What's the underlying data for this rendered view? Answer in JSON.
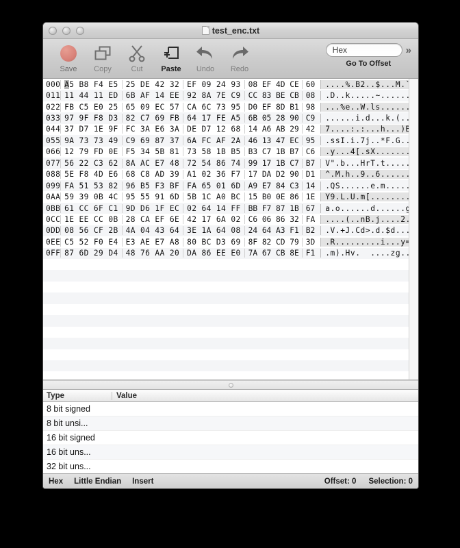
{
  "window": {
    "title": "test_enc.txt",
    "doc_icon": "document-icon",
    "traffic_lights": [
      "close-button",
      "minimize-button",
      "zoom-button"
    ]
  },
  "toolbar": {
    "items": [
      {
        "label": "Save",
        "icon": "save-icon",
        "state": "enabled-bold"
      },
      {
        "label": "Copy",
        "icon": "copy-icon",
        "state": "disabled"
      },
      {
        "label": "Cut",
        "icon": "cut-icon",
        "state": "disabled"
      },
      {
        "label": "Paste",
        "icon": "paste-icon",
        "state": "enabled-bold"
      },
      {
        "label": "Undo",
        "icon": "undo-icon",
        "state": "disabled"
      },
      {
        "label": "Redo",
        "icon": "redo-icon",
        "state": "disabled"
      }
    ],
    "goto_field_value": "Hex",
    "goto_label": "Go To Offset",
    "overflow_icon": "double-chevron-right-icon"
  },
  "hex_view": {
    "selected_byte_offset": "000",
    "rows": [
      {
        "offset": "000",
        "groups": [
          [
            "A5",
            "B8",
            "F4",
            "E5"
          ],
          [
            "25",
            "DE",
            "42",
            "32"
          ],
          [
            "EF",
            "09",
            "24",
            "93"
          ]
        ],
        "tail": "08 EF 4D CE",
        "last": "60",
        "ascii": "....%.B2..$...M.`"
      },
      {
        "offset": "011",
        "groups": [
          [
            "11",
            "44",
            "11",
            "ED"
          ],
          [
            "6B",
            "AF",
            "14",
            "EE"
          ],
          [
            "92",
            "8A",
            "7E",
            "C9"
          ]
        ],
        "tail": "CC 83 BE CB",
        "last": "08",
        "ascii": ".D..k.....~......"
      },
      {
        "offset": "022",
        "groups": [
          [
            "FB",
            "C5",
            "E0",
            "25"
          ],
          [
            "65",
            "09",
            "EC",
            "57"
          ],
          [
            "CA",
            "6C",
            "73",
            "95"
          ]
        ],
        "tail": "D0 EF 8D B1",
        "last": "98",
        "ascii": "...%e..W.ls......"
      },
      {
        "offset": "033",
        "groups": [
          [
            "97",
            "9F",
            "F8",
            "D3"
          ],
          [
            "82",
            "C7",
            "69",
            "FB"
          ],
          [
            "64",
            "17",
            "FE",
            "A5"
          ]
        ],
        "tail": "6B 05 28 90",
        "last": "C9",
        "ascii": "......i.d...k.(.."
      },
      {
        "offset": "044",
        "groups": [
          [
            "37",
            "D7",
            "1E",
            "9F"
          ],
          [
            "FC",
            "3A",
            "E6",
            "3A"
          ],
          [
            "DE",
            "D7",
            "12",
            "68"
          ]
        ],
        "tail": "14 A6 AB 29",
        "last": "42",
        "ascii": "7....:.:...h...)B"
      },
      {
        "offset": "055",
        "groups": [
          [
            "9A",
            "73",
            "73",
            "49"
          ],
          [
            "C9",
            "69",
            "87",
            "37"
          ],
          [
            "6A",
            "FC",
            "AF",
            "2A"
          ]
        ],
        "tail": "46 13 47 EC",
        "last": "95",
        "ascii": ".ssI.i.7j..*F.G.."
      },
      {
        "offset": "066",
        "groups": [
          [
            "12",
            "79",
            "FD",
            "0E"
          ],
          [
            "F5",
            "34",
            "5B",
            "81"
          ],
          [
            "73",
            "58",
            "1B",
            "B5"
          ]
        ],
        "tail": "B3 C7 1B B7",
        "last": "C6",
        "ascii": ".y...4[.sX......."
      },
      {
        "offset": "077",
        "groups": [
          [
            "56",
            "22",
            "C3",
            "62"
          ],
          [
            "8A",
            "AC",
            "E7",
            "48"
          ],
          [
            "72",
            "54",
            "86",
            "74"
          ]
        ],
        "tail": "99 17 1B C7",
        "last": "B7",
        "ascii": "V\".b...HrT.t....."
      },
      {
        "offset": "088",
        "groups": [
          [
            "5E",
            "F8",
            "4D",
            "E6"
          ],
          [
            "68",
            "C8",
            "AD",
            "39"
          ],
          [
            "A1",
            "02",
            "36",
            "F7"
          ]
        ],
        "tail": "17 DA D2 90",
        "last": "D1",
        "ascii": "^.M.h..9..6......"
      },
      {
        "offset": "099",
        "groups": [
          [
            "FA",
            "51",
            "53",
            "82"
          ],
          [
            "96",
            "B5",
            "F3",
            "BF"
          ],
          [
            "FA",
            "65",
            "01",
            "6D"
          ]
        ],
        "tail": "A9 E7 84 C3",
        "last": "14",
        "ascii": ".QS......e.m....."
      },
      {
        "offset": "0AA",
        "groups": [
          [
            "59",
            "39",
            "0B",
            "4C"
          ],
          [
            "95",
            "55",
            "91",
            "6D"
          ],
          [
            "5B",
            "1C",
            "A0",
            "BC"
          ]
        ],
        "tail": "15 B0 0E 86",
        "last": "1E",
        "ascii": "Y9.L.U.m[........"
      },
      {
        "offset": "0BB",
        "groups": [
          [
            "61",
            "CC",
            "6F",
            "C1"
          ],
          [
            "9D",
            "D6",
            "1F",
            "EC"
          ],
          [
            "02",
            "64",
            "14",
            "FF"
          ]
        ],
        "tail": "BB F7 87 1B",
        "last": "67",
        "ascii": "a.o......d......g"
      },
      {
        "offset": "0CC",
        "groups": [
          [
            "1E",
            "EE",
            "CC",
            "0B"
          ],
          [
            "28",
            "CA",
            "EF",
            "6E"
          ],
          [
            "42",
            "17",
            "6A",
            "02"
          ]
        ],
        "tail": "C6 06 86 32",
        "last": "FA",
        "ascii": "....(..nB.j....2."
      },
      {
        "offset": "0DD",
        "groups": [
          [
            "08",
            "56",
            "CF",
            "2B"
          ],
          [
            "4A",
            "04",
            "43",
            "64"
          ],
          [
            "3E",
            "1A",
            "64",
            "08"
          ]
        ],
        "tail": "24 64 A3 F1",
        "last": "B2",
        "ascii": ".V.+J.Cd>.d.$d..."
      },
      {
        "offset": "0EE",
        "groups": [
          [
            "C5",
            "52",
            "F0",
            "E4"
          ],
          [
            "E3",
            "AE",
            "E7",
            "A8"
          ],
          [
            "80",
            "BC",
            "D3",
            "69"
          ]
        ],
        "tail": "8F 82 CD 79",
        "last": "3D",
        "ascii": ".R.........i...y="
      },
      {
        "offset": "0FF",
        "groups": [
          [
            "87",
            "6D",
            "29",
            "D4"
          ],
          [
            "48",
            "76",
            "AA",
            "20"
          ],
          [
            "DA",
            "86",
            "EE",
            "E0"
          ]
        ],
        "tail": "7A 67 CB 8E",
        "last": "F1",
        "ascii": ".m).Hv.  ....zg..."
      }
    ]
  },
  "inspector": {
    "columns": [
      "Type",
      "Value"
    ],
    "rows": [
      {
        "type": "8 bit signed",
        "value": ""
      },
      {
        "type": "8 bit unsi...",
        "value": ""
      },
      {
        "type": "16 bit signed",
        "value": ""
      },
      {
        "type": "16 bit uns...",
        "value": ""
      },
      {
        "type": "32 bit uns...",
        "value": ""
      }
    ]
  },
  "statusbar": {
    "mode": "Hex",
    "endian": "Little Endian",
    "edit_mode": "Insert",
    "offset": "Offset: 0",
    "selection": "Selection: 0"
  }
}
